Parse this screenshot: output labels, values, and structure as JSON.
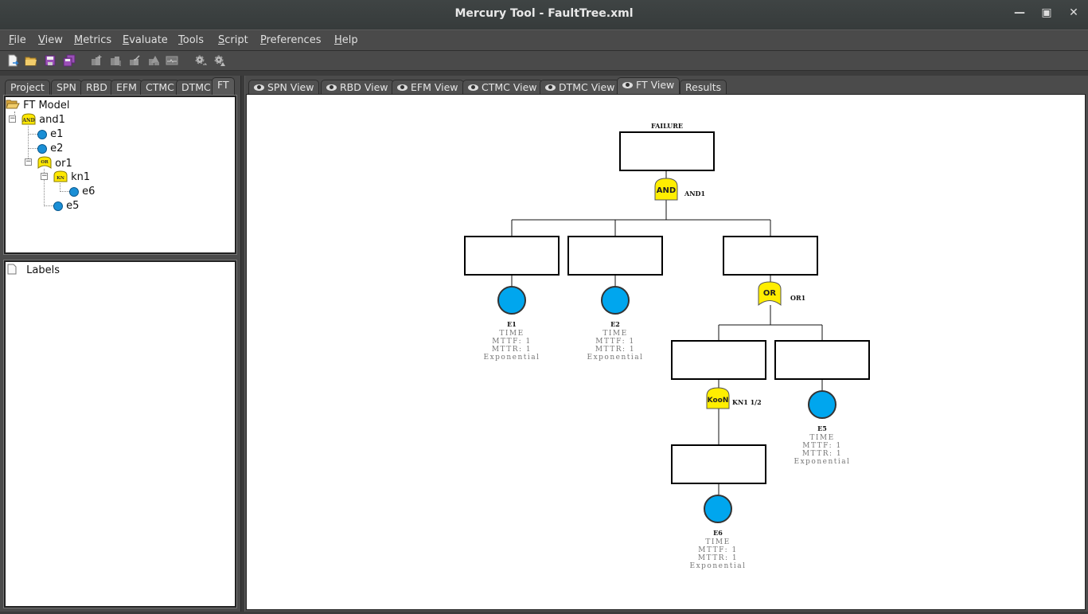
{
  "window": {
    "title": "Mercury Tool - FaultTree.xml",
    "controls": [
      "minimize",
      "maximize",
      "close"
    ]
  },
  "menubar": [
    {
      "label": "File",
      "mnemonic": "F"
    },
    {
      "label": "View",
      "mnemonic": "V"
    },
    {
      "label": "Metrics",
      "mnemonic": "M"
    },
    {
      "label": "Evaluate",
      "mnemonic": "E"
    },
    {
      "label": "Tools",
      "mnemonic": "T"
    },
    {
      "label": "Script",
      "mnemonic": "S"
    },
    {
      "label": "Preferences",
      "mnemonic": "P"
    },
    {
      "label": "Help",
      "mnemonic": "H"
    }
  ],
  "toolbar": {
    "icons": [
      "new-file-icon",
      "open-folder-icon",
      "save-icon",
      "save-all-icon",
      "add-component-icon",
      "remove-component-icon",
      "edit-component-icon",
      "warning-component-icon",
      "chart-icon",
      "settings-run-icon",
      "settings-warning-icon"
    ]
  },
  "left_tabs": [
    "Project",
    "SPN",
    "RBD",
    "EFM",
    "CTMC",
    "DTMC",
    "FT"
  ],
  "left_active_tab": "FT",
  "tree": {
    "root": "FT Model",
    "nodes": [
      {
        "label": "and1",
        "type": "AND",
        "badge": "AND",
        "depth": 1
      },
      {
        "label": "e1",
        "type": "event",
        "depth": 2
      },
      {
        "label": "e2",
        "type": "event",
        "depth": 2
      },
      {
        "label": "or1",
        "type": "OR",
        "badge": "OR",
        "depth": 2
      },
      {
        "label": "kn1",
        "type": "KooN",
        "badge": "KN",
        "depth": 3
      },
      {
        "label": "e6",
        "type": "event",
        "depth": 4
      },
      {
        "label": "e5",
        "type": "event",
        "depth": 3
      }
    ]
  },
  "labels_panel": {
    "title": "Labels"
  },
  "view_tabs": [
    "SPN View",
    "RBD View",
    "EFM View",
    "CTMC View",
    "DTMC View",
    "FT View",
    "Results"
  ],
  "view_active_tab": "FT View",
  "fault_tree": {
    "top_event": "FAILURE",
    "gates": [
      {
        "id": "and1",
        "symbol": "AND",
        "label": "AND1"
      },
      {
        "id": "or1",
        "symbol": "OR",
        "label": "OR1"
      },
      {
        "id": "kn1",
        "symbol": "KooN",
        "label": "KN1 1/2"
      }
    ],
    "events": [
      {
        "id": "E1",
        "lines": [
          "TIME",
          "MTTF: 1",
          "MTTR: 1",
          "Exponential"
        ]
      },
      {
        "id": "E2",
        "lines": [
          "TIME",
          "MTTF: 1",
          "MTTR: 1",
          "Exponential"
        ]
      },
      {
        "id": "E5",
        "lines": [
          "TIME",
          "MTTF: 1",
          "MTTR: 1",
          "Exponential"
        ]
      },
      {
        "id": "E6",
        "lines": [
          "TIME",
          "MTTF: 1",
          "MTTR: 1",
          "Exponential"
        ]
      }
    ],
    "colors": {
      "gate_fill": "#ffee00",
      "event_fill": "#00a6ee",
      "detail_text": "#777777"
    }
  }
}
